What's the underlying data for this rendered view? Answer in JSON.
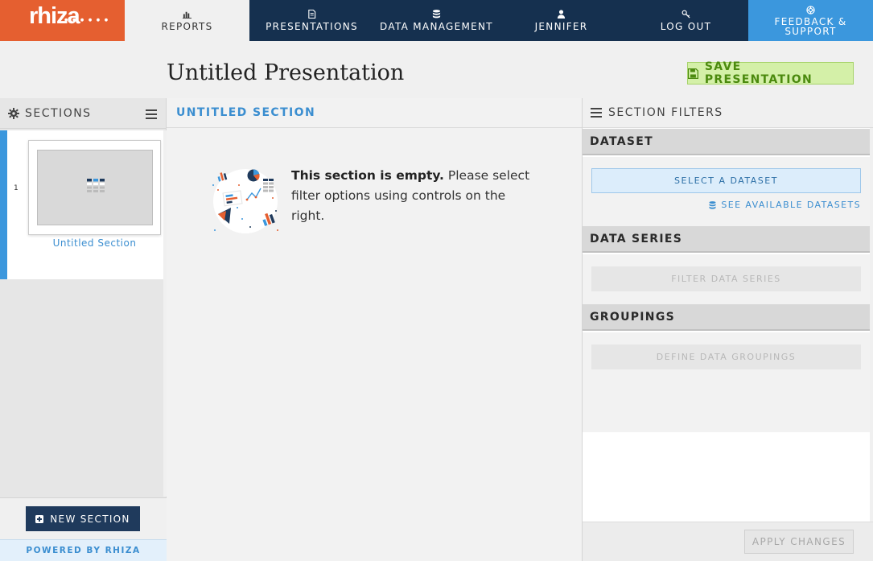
{
  "brand": {
    "logo_text": "rhiza",
    "accent": "#e55f30"
  },
  "nav": {
    "reports": "REPORTS",
    "presentations": "PRESENTATIONS",
    "data_management": "DATA MANAGEMENT",
    "user": "JENNIFER",
    "logout": "LOG OUT",
    "feedback": "FEEDBACK & SUPPORT"
  },
  "page": {
    "title": "Untitled Presentation",
    "save_label": "SAVE PRESENTATION"
  },
  "sections_panel": {
    "heading": "SECTIONS",
    "items": [
      {
        "number": "1",
        "label": "Untitled Section"
      }
    ],
    "new_section_label": "NEW SECTION",
    "powered_by": "POWERED BY RHIZA"
  },
  "main": {
    "section_title": "UNTITLED SECTION",
    "empty_bold": "This section is empty.",
    "empty_rest": " Please select filter options using controls on the right."
  },
  "filters": {
    "heading": "SECTION FILTERS",
    "dataset": {
      "title": "DATASET",
      "button": "SELECT A DATASET",
      "link": "SEE AVAILABLE DATASETS"
    },
    "series": {
      "title": "DATA SERIES",
      "button": "FILTER DATA SERIES"
    },
    "groupings": {
      "title": "GROUPINGS",
      "button": "DEFINE DATA GROUPINGS"
    },
    "apply_label": "APPLY CHANGES"
  }
}
